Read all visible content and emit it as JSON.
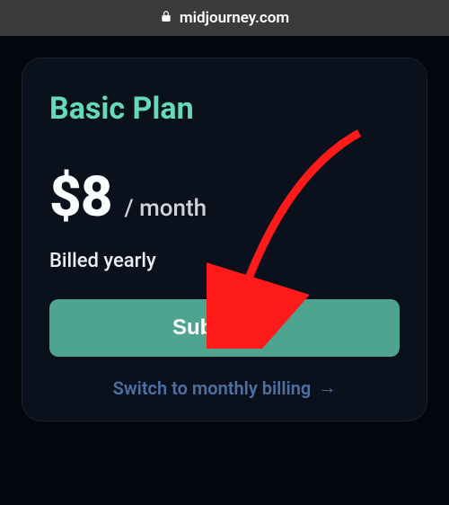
{
  "browser": {
    "domain": "midjourney.com"
  },
  "card": {
    "title": "Basic Plan",
    "price": "$8",
    "period": "/ month",
    "billing_note": "Billed yearly",
    "subscribe_label": "Subscribe",
    "switch_label": "Switch to monthly billing",
    "switch_arrow": "→"
  },
  "colors": {
    "accent": "#66d9b8",
    "button": "#4fa48f",
    "link": "#4d70a1",
    "card_bg": "#0b111c",
    "page_bg": "#02060d"
  }
}
